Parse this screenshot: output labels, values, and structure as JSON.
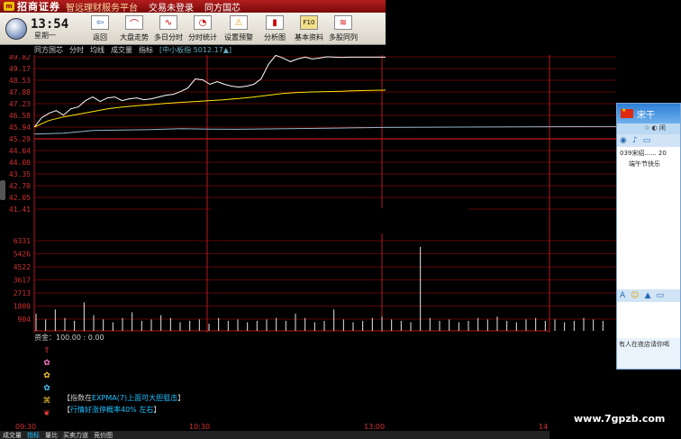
{
  "topbar": {
    "brand": "招商证券",
    "slogan": "智远理财服务平台",
    "items": [
      "交易未登录",
      "同方国芯"
    ]
  },
  "clock": {
    "time": "13:54",
    "day": "星期一"
  },
  "toolbar": {
    "tools": [
      {
        "label": "返回",
        "icon": "back-arrow-icon"
      },
      {
        "label": "大盘走势",
        "icon": "market-trend-icon"
      },
      {
        "label": "多日分时",
        "icon": "multi-day-icon"
      },
      {
        "label": "分时统计",
        "icon": "pie-icon"
      },
      {
        "label": "设置预警",
        "icon": "warning-icon"
      },
      {
        "label": "分析图",
        "icon": "candle-icon"
      },
      {
        "label": "基本资料",
        "icon": "f10-icon"
      },
      {
        "label": "多股同列",
        "icon": "multi-stock-icon"
      }
    ],
    "f10": "F10"
  },
  "chart_header": {
    "stock": "同方国芯",
    "items": [
      "分时",
      "均线",
      "成交量",
      "指标"
    ],
    "index_label": "[中小板指 5012.17▲]"
  },
  "chart_data": {
    "type": "line",
    "price_axis": [
      "49.82",
      "49.17",
      "48.53",
      "47.88",
      "47.23",
      "46.58",
      "45.94",
      "45.29",
      "44.64",
      "44.00",
      "43.35",
      "42.70",
      "42.05",
      "41.41"
    ],
    "volume_axis": [
      "6331",
      "5426",
      "4522",
      "3617",
      "2713",
      "1809",
      "904"
    ],
    "time_ticks": [
      "09:30",
      "10:30",
      "13:00",
      "14"
    ],
    "series": [
      {
        "name": "",
        "color": "#ffffff",
        "x": [
          0,
          5,
          10,
          15,
          20,
          25,
          30,
          35,
          40,
          45,
          50,
          55,
          60,
          65,
          70,
          75,
          80,
          85,
          90,
          95,
          100,
          105,
          110,
          115,
          120,
          125,
          130,
          135,
          140,
          145,
          150,
          155,
          160,
          165,
          170,
          175,
          180,
          185,
          190,
          195,
          200,
          205,
          210,
          215,
          220,
          225,
          230,
          235,
          240
        ],
        "values": [
          45.94,
          46.45,
          46.7,
          46.85,
          46.6,
          46.95,
          47.05,
          47.4,
          47.6,
          47.35,
          47.55,
          47.6,
          47.4,
          47.5,
          47.55,
          47.45,
          47.5,
          47.6,
          47.7,
          47.75,
          47.9,
          48.1,
          48.6,
          48.55,
          48.3,
          48.45,
          48.3,
          48.2,
          48.15,
          48.2,
          48.3,
          48.6,
          49.4,
          49.9,
          49.75,
          49.55,
          49.7,
          49.8,
          49.7,
          49.75,
          49.82,
          49.8,
          49.78,
          49.8,
          49.8,
          49.8,
          49.8,
          49.8,
          49.8
        ]
      },
      {
        "name": "",
        "color": "#ffe600",
        "x": [
          0,
          10,
          20,
          30,
          40,
          50,
          60,
          70,
          80,
          90,
          100,
          110,
          120,
          130,
          140,
          150,
          160,
          170,
          180,
          190,
          200,
          210,
          220,
          230,
          240
        ],
        "values": [
          45.94,
          46.3,
          46.5,
          46.65,
          46.8,
          46.95,
          47.05,
          47.12,
          47.18,
          47.25,
          47.3,
          47.35,
          47.4,
          47.45,
          47.52,
          47.6,
          47.7,
          47.8,
          47.85,
          47.88,
          47.9,
          47.92,
          47.95,
          47.97,
          47.98
        ]
      },
      {
        "name": "",
        "color": "#8fb6cc",
        "x": [
          0,
          20,
          40,
          60,
          80,
          100,
          120,
          140,
          160,
          180,
          200,
          220,
          240
        ],
        "values": [
          45.55,
          45.6,
          45.75,
          45.78,
          45.8,
          45.85,
          45.83,
          45.82,
          45.84,
          45.86,
          45.88,
          45.9,
          45.92
        ]
      }
    ],
    "volume": [
      1200,
      800,
      1500,
      900,
      700,
      2000,
      1100,
      800,
      600,
      900,
      1300,
      700,
      800,
      1100,
      900,
      600,
      700,
      800,
      500,
      900,
      700,
      800,
      600,
      700,
      800,
      900,
      700,
      1200,
      900,
      600,
      700,
      1500,
      800,
      600,
      700,
      900,
      1000,
      800,
      700,
      600,
      5900,
      900,
      700,
      800,
      600,
      700,
      900,
      800,
      1000,
      700,
      600,
      800,
      900,
      700,
      800,
      600,
      700,
      900,
      800,
      700
    ],
    "ylim": [
      41.41,
      49.82
    ]
  },
  "fund": "资金：100.00 : 0.00",
  "signals": [
    "⇧",
    "✿",
    "✿",
    "✿",
    "⌘",
    "❦"
  ],
  "tips": [
    {
      "prefix": "【指数在",
      "highlight": "EXPMA(7)上面可大胆狙击",
      "suffix": "】"
    },
    {
      "prefix": "【",
      "highlight": "行情好涨停概率40% 左右",
      "suffix": "】"
    }
  ],
  "bottom_tabs": [
    "成交量",
    "指标",
    "量比",
    "买卖力道",
    "竞价图"
  ],
  "chat": {
    "name": "宋干",
    "sub_text": "☆ ◐ 闲",
    "messages": [
      "039宋绍......  20",
      "端午节快乐"
    ],
    "status": "有人在夜店请你喝"
  },
  "watermark": "www.7gpzb.com"
}
